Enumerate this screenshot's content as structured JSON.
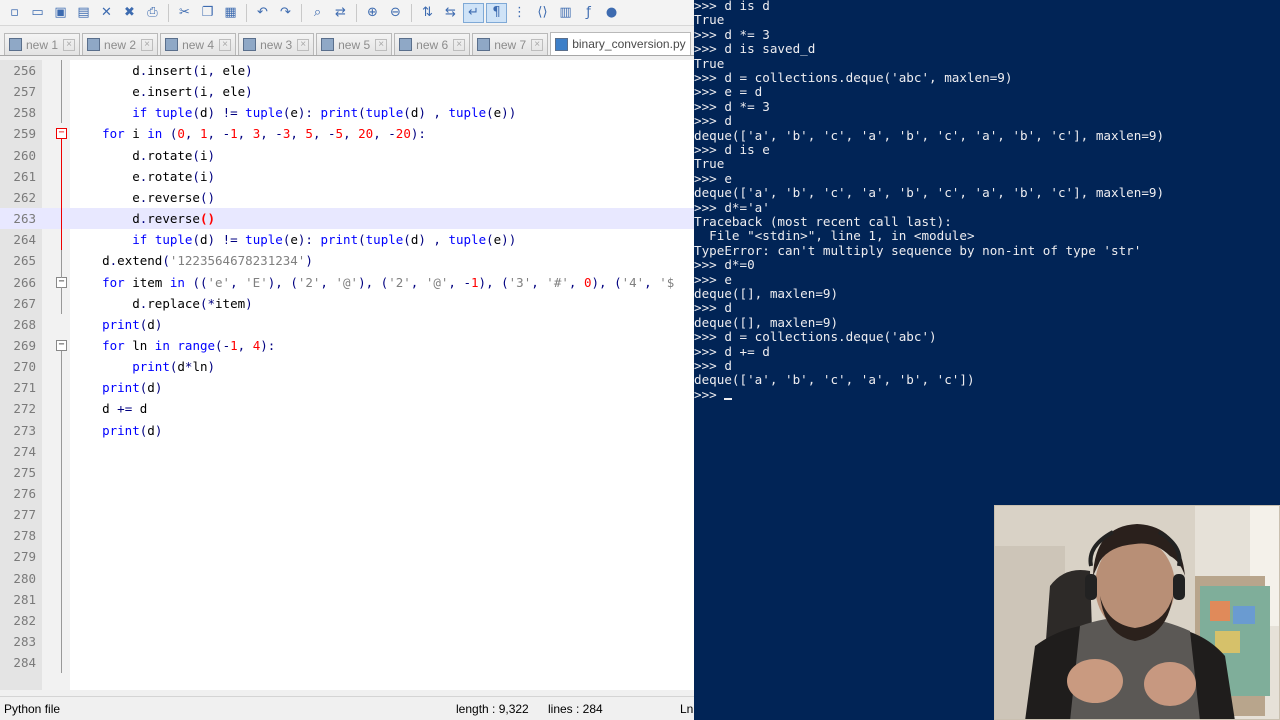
{
  "toolbar": {
    "icons": [
      "new-file",
      "open",
      "save",
      "save-all",
      "close",
      "close-all",
      "print",
      "cut",
      "copy",
      "paste",
      "undo",
      "redo",
      "find",
      "replace",
      "zoom-in",
      "zoom-out",
      "sync-v",
      "sync-h",
      "word-wrap",
      "show-all",
      "indent-guide",
      "lang",
      "map",
      "func",
      "rec"
    ]
  },
  "tabs": [
    {
      "label": "new 1"
    },
    {
      "label": "new 2"
    },
    {
      "label": "new 4"
    },
    {
      "label": "new 3"
    },
    {
      "label": "new 5"
    },
    {
      "label": "new 6"
    },
    {
      "label": "new 7"
    },
    {
      "label": "binary_conversion.py"
    }
  ],
  "code_lines": [
    {
      "n": "256",
      "text": "        d.insert(i, ele)"
    },
    {
      "n": "257",
      "text": "        e.insert(i, ele)"
    },
    {
      "n": "258",
      "text": "        if tuple(d) != tuple(e): print(tuple(d) , tuple(e))"
    },
    {
      "n": "259",
      "text": "    for i in (0, 1, -1, 3, -3, 5, -5, 20, -20):"
    },
    {
      "n": "260",
      "text": "        d.rotate(i)"
    },
    {
      "n": "261",
      "text": "        e.rotate(i)"
    },
    {
      "n": "262",
      "text": "        e.reverse()"
    },
    {
      "n": "263",
      "text": "        d.reverse()"
    },
    {
      "n": "264",
      "text": "        if tuple(d) != tuple(e): print(tuple(d) , tuple(e))"
    },
    {
      "n": "265",
      "text": "    d.extend('1223564678231234')"
    },
    {
      "n": "266",
      "text": "    for item in (('e', 'E'), ('2', '@'), ('2', '@', -1), ('3', '#', 0), ('4', '$"
    },
    {
      "n": "267",
      "text": "        d.replace(*item)"
    },
    {
      "n": "268",
      "text": "    print(d)"
    },
    {
      "n": "269",
      "text": "    for ln in range(-1, 4):"
    },
    {
      "n": "270",
      "text": "        print(d*ln)"
    },
    {
      "n": "271",
      "text": "    print(d)"
    },
    {
      "n": "272",
      "text": "    d += d"
    },
    {
      "n": "273",
      "text": "    print(d)"
    },
    {
      "n": "274",
      "text": ""
    },
    {
      "n": "275",
      "text": ""
    },
    {
      "n": "276",
      "text": ""
    },
    {
      "n": "277",
      "text": ""
    },
    {
      "n": "278",
      "text": ""
    },
    {
      "n": "279",
      "text": ""
    },
    {
      "n": "280",
      "text": ""
    },
    {
      "n": "281",
      "text": ""
    },
    {
      "n": "282",
      "text": ""
    },
    {
      "n": "283",
      "text": ""
    },
    {
      "n": "284",
      "text": ""
    }
  ],
  "statusbar": {
    "filetype": "Python file",
    "length": "length : 9,322",
    "lines": "lines : 284",
    "ln": "Ln"
  },
  "console_lines": [
    ">>> d is d",
    "True",
    ">>> d *= 3",
    ">>> d is saved_d",
    "True",
    ">>> d = collections.deque('abc', maxlen=9)",
    ">>> e = d",
    ">>> d *= 3",
    ">>> d",
    "deque(['a', 'b', 'c', 'a', 'b', 'c', 'a', 'b', 'c'], maxlen=9)",
    ">>> d is e",
    "True",
    ">>> e",
    "deque(['a', 'b', 'c', 'a', 'b', 'c', 'a', 'b', 'c'], maxlen=9)",
    ">>> d*='a'",
    "Traceback (most recent call last):",
    "  File \"<stdin>\", line 1, in <module>",
    "TypeError: can't multiply sequence by non-int of type 'str'",
    ">>> d*=0",
    ">>> e",
    "deque([], maxlen=9)",
    ">>> d",
    "deque([], maxlen=9)",
    ">>> d = collections.deque('abc')",
    ">>> d += d",
    ">>> d",
    "deque(['a', 'b', 'c', 'a', 'b', 'c'])",
    ">>> "
  ],
  "colors": {
    "console_bg": "#012456",
    "console_fg": "#eeedf0",
    "keyword": "#0000ff",
    "number": "#ff0000",
    "string": "#808080",
    "current_line": "#e8e8ff"
  }
}
